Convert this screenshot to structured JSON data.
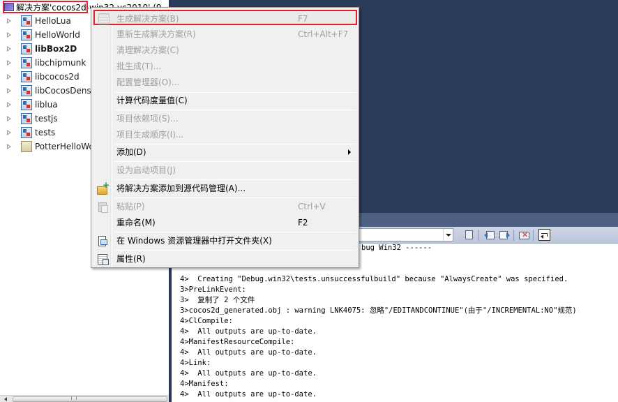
{
  "explorer": {
    "solution_label": "解决方案'cocos2d-win32.vc2010' (9",
    "projects": [
      {
        "name": "HelloLua",
        "bold": false
      },
      {
        "name": "HelloWorld",
        "bold": false
      },
      {
        "name": "libBox2D",
        "bold": true
      },
      {
        "name": "libchipmunk",
        "bold": false
      },
      {
        "name": "libcocos2d",
        "bold": false
      },
      {
        "name": "libCocosDens",
        "bold": false
      },
      {
        "name": "liblua",
        "bold": false
      },
      {
        "name": "testjs",
        "bold": false
      },
      {
        "name": "tests",
        "bold": false
      },
      {
        "name": "PotterHelloWo",
        "bold": false
      }
    ]
  },
  "context_menu": {
    "items": [
      {
        "label": "生成解决方案(B)",
        "shortcut": "F7",
        "disabled": true
      },
      {
        "label": "重新生成解决方案(R)",
        "shortcut": "Ctrl+Alt+F7",
        "disabled": true
      },
      {
        "label": "清理解决方案(C)",
        "shortcut": "",
        "disabled": true
      },
      {
        "label": "批生成(T)...",
        "shortcut": "",
        "disabled": true
      },
      {
        "label": "配置管理器(O)...",
        "shortcut": "",
        "disabled": true
      },
      {
        "label": "计算代码度量值(C)",
        "shortcut": "",
        "disabled": false
      },
      {
        "label": "项目依赖项(S)...",
        "shortcut": "",
        "disabled": true
      },
      {
        "label": "项目生成顺序(I)...",
        "shortcut": "",
        "disabled": true
      },
      {
        "label": "添加(D)",
        "shortcut": "",
        "disabled": false
      },
      {
        "label": "设为启动项目(J)",
        "shortcut": "",
        "disabled": true
      },
      {
        "label": "将解决方案添加到源代码管理(A)...",
        "shortcut": "",
        "disabled": false
      },
      {
        "label": "粘贴(P)",
        "shortcut": "Ctrl+V",
        "disabled": true
      },
      {
        "label": "重命名(M)",
        "shortcut": "F2",
        "disabled": false
      },
      {
        "label": "在 Windows 资源管理器中打开文件夹(X)",
        "shortcut": "",
        "disabled": false
      },
      {
        "label": "属性(R)",
        "shortcut": "",
        "disabled": false
      }
    ]
  },
  "output": {
    "partial_header": "bug Win32 ------",
    "lines": [
      "4>  Creating \"Debug.win32\\tests.unsuccessfulbuild\" because \"AlwaysCreate\" was specified.",
      "3>PreLinkEvent:",
      "3>  复制了 2 个文件",
      "3>cocos2d_generated.obj : warning LNK4075: 忽略\"/EDITANDCONTINUE\"(由于\"/INCREMENTAL:NO\"规范)",
      "4>ClCompile:",
      "4>  All outputs are up-to-date.",
      "4>ManifestResourceCompile:",
      "4>  All outputs are up-to-date.",
      "4>Link:",
      "4>  All outputs are up-to-date.",
      "4>Manifest:",
      "4>  All outputs are up-to-date."
    ]
  },
  "icons": {
    "build": "build-solution-icon",
    "add_to_source_control": "add-folder-icon",
    "paste": "paste-icon",
    "open_folder": "open-folder-icon",
    "properties": "properties-icon"
  }
}
